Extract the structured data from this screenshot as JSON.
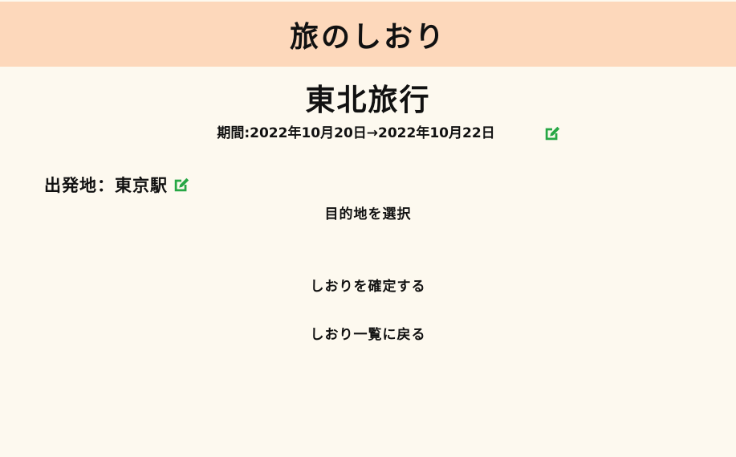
{
  "header": {
    "title": "旅のしおり"
  },
  "trip": {
    "title": "東北旅行",
    "period": "期間:2022年10月20日→2022年10月22日",
    "departure": "出発地：東京駅"
  },
  "actions": {
    "select_destination": "目的地を選択",
    "confirm": "しおりを確定する",
    "back_to_list": "しおり一覧に戻る"
  },
  "icons": {
    "edit_period": "edit-icon",
    "edit_departure": "edit-icon"
  },
  "colors": {
    "header_bg": "#fdd8bb",
    "page_bg": "#fdf9ef",
    "icon_green": "#27a745"
  }
}
